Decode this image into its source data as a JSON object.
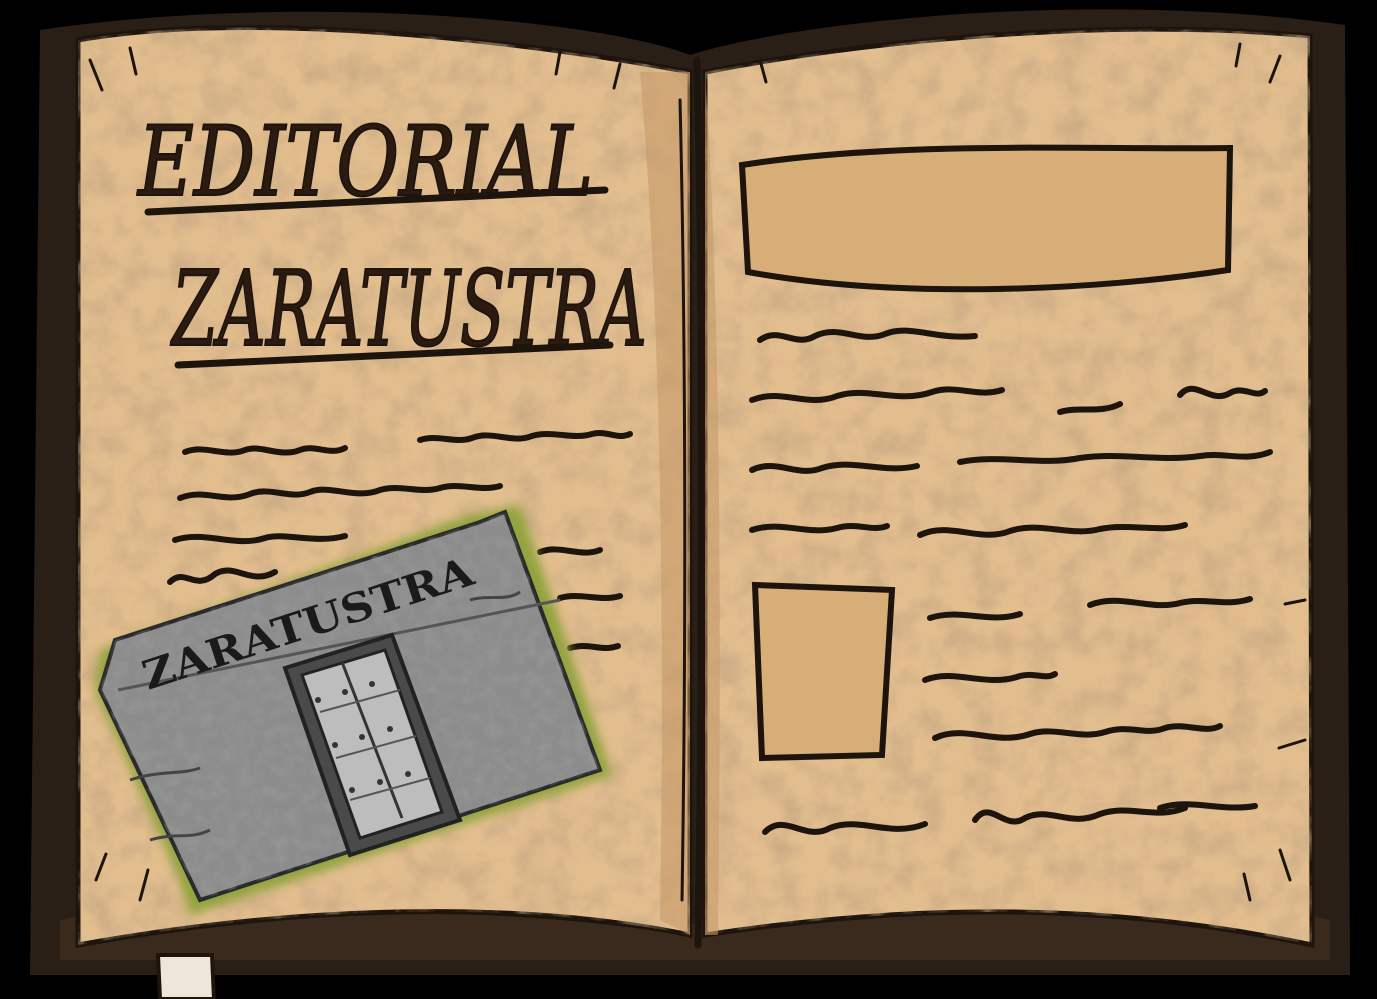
{
  "book": {
    "title_line1": "EDITORIAL",
    "title_line2": "ZARATUSTRA",
    "photo_sign": "ZARATUSTRA"
  },
  "colors": {
    "background": "#000000",
    "paper": "#e2bd8e",
    "paper_dark": "#c49866",
    "ink": "#1c140d",
    "cover": "#2a1f16",
    "photo_wall": "#8c8c8c",
    "photo_glow": "#8ea33a",
    "bookmark": "#efe6da"
  }
}
